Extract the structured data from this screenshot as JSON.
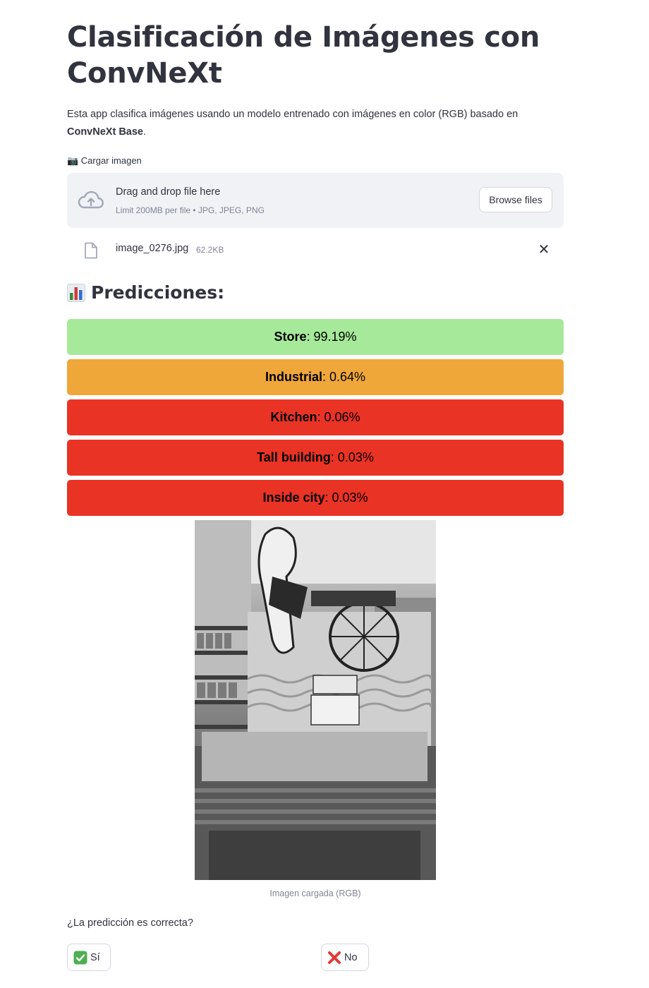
{
  "page": {
    "title": "Clasificación de Imágenes con ConvNeXt",
    "description_prefix": "Esta app clasifica imágenes usando un modelo entrenado con imágenes en color (RGB) basado en ",
    "description_bold": "ConvNeXt Base",
    "description_suffix": "."
  },
  "uploader": {
    "label": "📷 Cargar imagen",
    "title": "Drag and drop file here",
    "limit": "Limit 200MB per file • JPG, JPEG, PNG",
    "browse_label": "Browse files",
    "icon": "cloud-upload-icon"
  },
  "file": {
    "name": "image_0276.jpg",
    "size": "62.2KB",
    "icon": "file-icon",
    "remove_icon": "close-icon"
  },
  "predictions": {
    "heading": "Predicciones:",
    "icon": "bar-chart-icon",
    "items": [
      {
        "label": "Store",
        "value": ": 99.19%",
        "color": "#a6e99a"
      },
      {
        "label": "Industrial",
        "value": ": 0.64%",
        "color": "#f0a73a"
      },
      {
        "label": "Kitchen",
        "value": ": 0.06%",
        "color": "#e93325"
      },
      {
        "label": "Tall building",
        "value": ": 0.03%",
        "color": "#e93325"
      },
      {
        "label": "Inside city",
        "value": ": 0.03%",
        "color": "#e93325"
      }
    ]
  },
  "image": {
    "caption": "Imagen cargada (RGB)"
  },
  "feedback": {
    "question": "¿La predicción es correcta?",
    "yes_label": "Sí",
    "no_label": "No",
    "yes_icon": "check-mark-icon",
    "no_icon": "cross-mark-icon",
    "yes_color": "#4caf50",
    "no_color": "#e53935"
  }
}
